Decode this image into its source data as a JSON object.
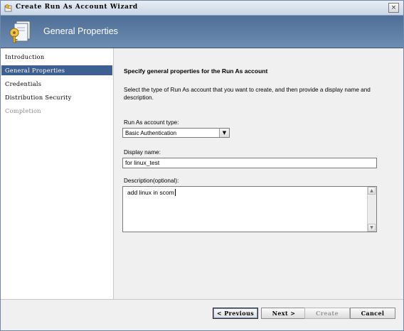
{
  "window": {
    "title": "Create Run As Account Wizard",
    "close_label": "×"
  },
  "header": {
    "title": "General Properties",
    "icon": "key-document-icon"
  },
  "sidebar": {
    "items": [
      {
        "label": "Introduction",
        "state": "normal"
      },
      {
        "label": "General Properties",
        "state": "active"
      },
      {
        "label": "Credentials",
        "state": "normal"
      },
      {
        "label": "Distribution Security",
        "state": "normal"
      },
      {
        "label": "Completion",
        "state": "disabled"
      }
    ]
  },
  "main": {
    "heading": "Specify general properties for the Run As account",
    "description": "Select the type of Run As account that you want to create, and then provide a display name and description.",
    "account_type_label": "Run As account type:",
    "account_type_value": "Basic Authentication",
    "display_name_label": "Display name:",
    "display_name_value": "for  linux_test",
    "description_label": "Description(optional):",
    "description_value": "add linux in scom"
  },
  "footer": {
    "previous_label": "< Previous",
    "next_label": "Next >",
    "create_label": "Create",
    "cancel_label": "Cancel"
  },
  "colors": {
    "header_bg": "#5b7ca3",
    "active_nav_bg": "#3e5f92",
    "disabled_text": "#8a8a8a"
  }
}
